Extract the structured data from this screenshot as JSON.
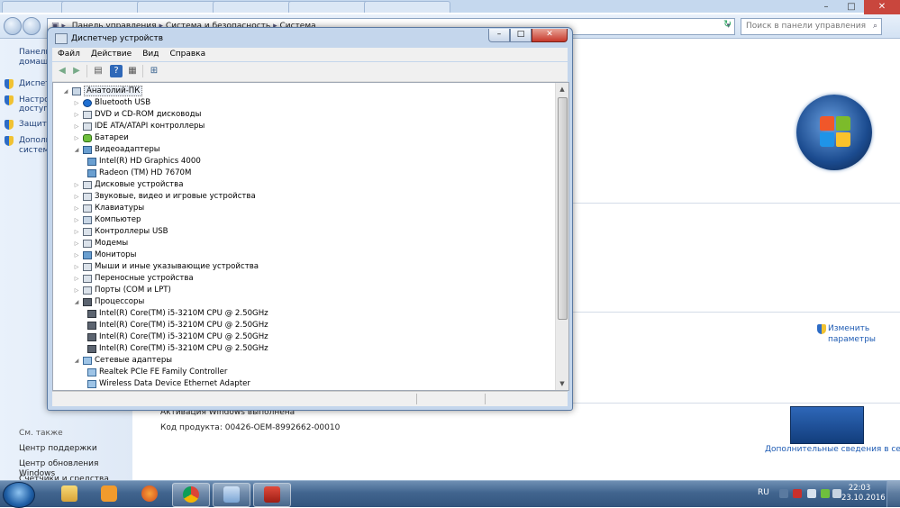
{
  "background_window": {
    "address_crumbs": [
      "Панель управления",
      "Система и безопасность",
      "Система"
    ],
    "search_placeholder": "Поиск в панели управления",
    "left_links": [
      "Панель",
      "домаш",
      "Диспет",
      "Настро",
      "доступ",
      "Защита",
      "Дополн",
      "систем"
    ],
    "see_also_title": "См. также",
    "see_also_links": [
      "Центр поддержки",
      "Центр обновления Windows",
      "Счетчики и средства"
    ],
    "change_params_line1": "Изменить",
    "change_params_line2": "параметры",
    "activation_text": "Активация Windows выполнена",
    "product_key_text": "Код продукта: 00426-OEM-8992662-00010",
    "genuine_link": "Дополнительные сведения в сети..."
  },
  "device_manager": {
    "title": "Диспетчер устройств",
    "menu": [
      "Файл",
      "Действие",
      "Вид",
      "Справка"
    ],
    "root": "Анатолий-ПК",
    "categories": [
      {
        "label": "Bluetooth USB",
        "icon": "bluetooth-icon",
        "expanded": false
      },
      {
        "label": "DVD и CD-ROM дисководы",
        "icon": "dvd-drive-icon",
        "expanded": false
      },
      {
        "label": "IDE ATA/ATAPI контроллеры",
        "icon": "ide-controller-icon",
        "expanded": false
      },
      {
        "label": "Батареи",
        "icon": "battery-icon",
        "expanded": false
      },
      {
        "label": "Видеоадаптеры",
        "icon": "display-adapter-icon",
        "expanded": true,
        "children": [
          "Intel(R) HD Graphics 4000",
          "Radeon (TM)  HD 7670M"
        ]
      },
      {
        "label": "Дисковые устройства",
        "icon": "disk-drive-icon",
        "expanded": false
      },
      {
        "label": "Звуковые, видео и игровые устройства",
        "icon": "speaker-icon",
        "expanded": false
      },
      {
        "label": "Клавиатуры",
        "icon": "keyboard-icon",
        "expanded": false
      },
      {
        "label": "Компьютер",
        "icon": "computer-icon",
        "expanded": false
      },
      {
        "label": "Контроллеры USB",
        "icon": "usb-icon",
        "expanded": false
      },
      {
        "label": "Модемы",
        "icon": "modem-icon",
        "expanded": false
      },
      {
        "label": "Мониторы",
        "icon": "monitor-icon",
        "expanded": false
      },
      {
        "label": "Мыши и иные указывающие устройства",
        "icon": "mouse-icon",
        "expanded": false
      },
      {
        "label": "Переносные устройства",
        "icon": "portable-device-icon",
        "expanded": false
      },
      {
        "label": "Порты (COM и LPT)",
        "icon": "port-icon",
        "expanded": false
      },
      {
        "label": "Процессоры",
        "icon": "processor-icon",
        "expanded": true,
        "children": [
          "Intel(R) Core(TM) i5-3210M CPU @ 2.50GHz",
          "Intel(R) Core(TM) i5-3210M CPU @ 2.50GHz",
          "Intel(R) Core(TM) i5-3210M CPU @ 2.50GHz",
          "Intel(R) Core(TM) i5-3210M CPU @ 2.50GHz"
        ]
      },
      {
        "label": "Сетевые адаптеры",
        "icon": "network-adapter-icon",
        "expanded": true,
        "children": [
          "Realtek PCIe FE Family Controller",
          "Wireless Data Device Ethernet Adapter"
        ]
      }
    ]
  },
  "taskbar": {
    "language": "RU",
    "time": "22:03",
    "date": "23.10.2016"
  },
  "colors": {
    "accent": "#2f5b8a",
    "close_red": "#c7382b"
  }
}
